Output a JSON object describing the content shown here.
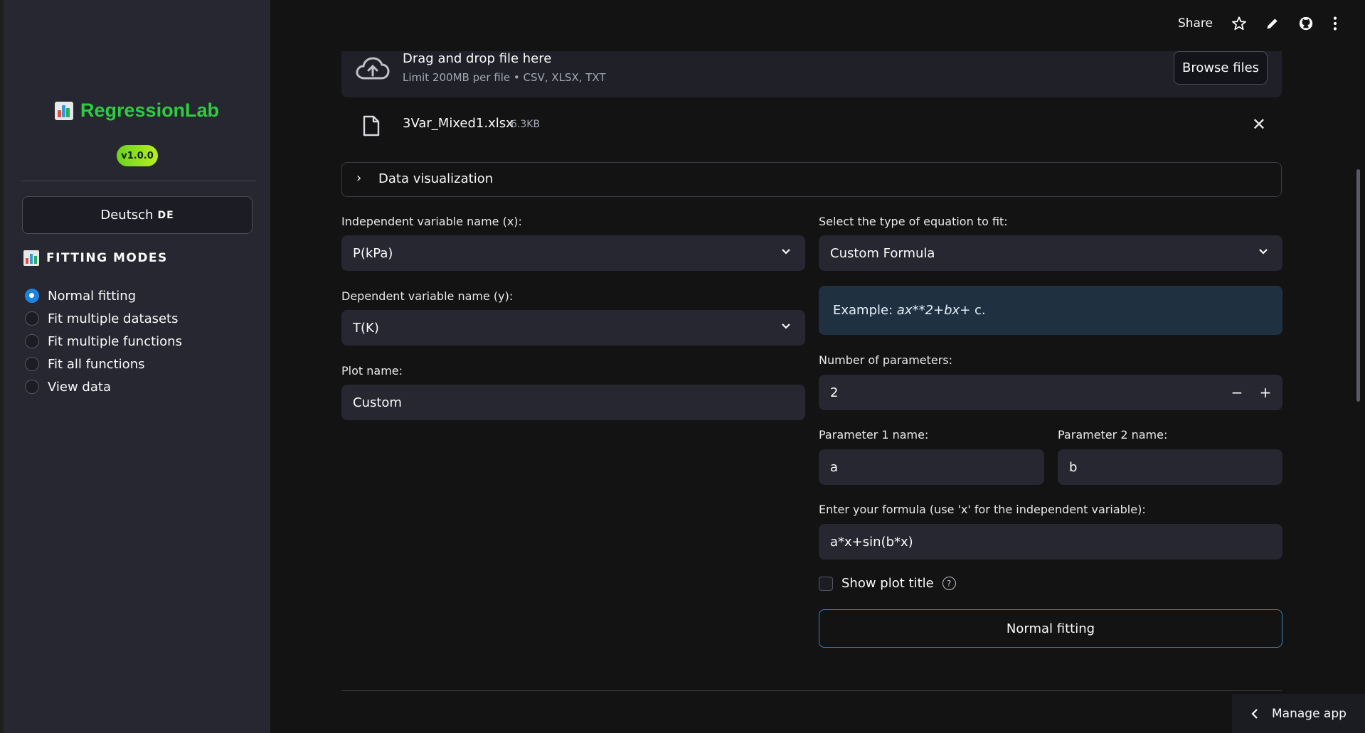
{
  "sidebar": {
    "app_title": "RegressionLab",
    "version": "v1.0.0",
    "language_button": "Deutsch",
    "language_code": "DE",
    "modes_heading": "FITTING MODES",
    "modes": [
      {
        "label": "Normal fitting",
        "selected": true
      },
      {
        "label": "Fit multiple datasets",
        "selected": false
      },
      {
        "label": "Fit multiple functions",
        "selected": false
      },
      {
        "label": "Fit all functions",
        "selected": false
      },
      {
        "label": "View data",
        "selected": false
      }
    ]
  },
  "header": {
    "share_label": "Share",
    "icons": [
      "star-icon",
      "pencil-icon",
      "github-icon",
      "more-vertical-icon"
    ]
  },
  "uploader": {
    "title": "Drag and drop file here",
    "subtitle": "Limit 200MB per file • CSV, XLSX, TXT",
    "browse_label": "Browse files",
    "file_name": "3Var_Mixed1.xlsx",
    "file_size": "6.3KB"
  },
  "expander": {
    "label": "Data visualization"
  },
  "form": {
    "x_label": "Independent variable name (x):",
    "x_value": "P(kPa)",
    "y_label": "Dependent variable name (y):",
    "y_value": "T(K)",
    "plot_label": "Plot name:",
    "plot_value": "Custom",
    "eq_label": "Select the type of equation to fit:",
    "eq_value": "Custom Formula",
    "example_prefix": "Example: ",
    "example_a": "ax**2",
    "example_plus1": " + ",
    "example_b": "bx",
    "example_suffix": " + c.",
    "nparams_label": "Number of parameters:",
    "nparams_value": "2",
    "stepper_minus": "−",
    "stepper_plus": "+",
    "p1_label": "Parameter 1 name:",
    "p1_value": "a",
    "p2_label": "Parameter 2 name:",
    "p2_value": "b",
    "formula_label": "Enter your formula (use 'x' for the independent variable):",
    "formula_value": "a*x+sin(b*x)",
    "show_title_label": "Show plot title",
    "help_glyph": "?",
    "fit_button": "Normal fitting"
  },
  "manage_app": "Manage app",
  "colors": {
    "accent": "#1c83e1",
    "title": "#2ecc40",
    "info_bg": "#1f3141"
  }
}
